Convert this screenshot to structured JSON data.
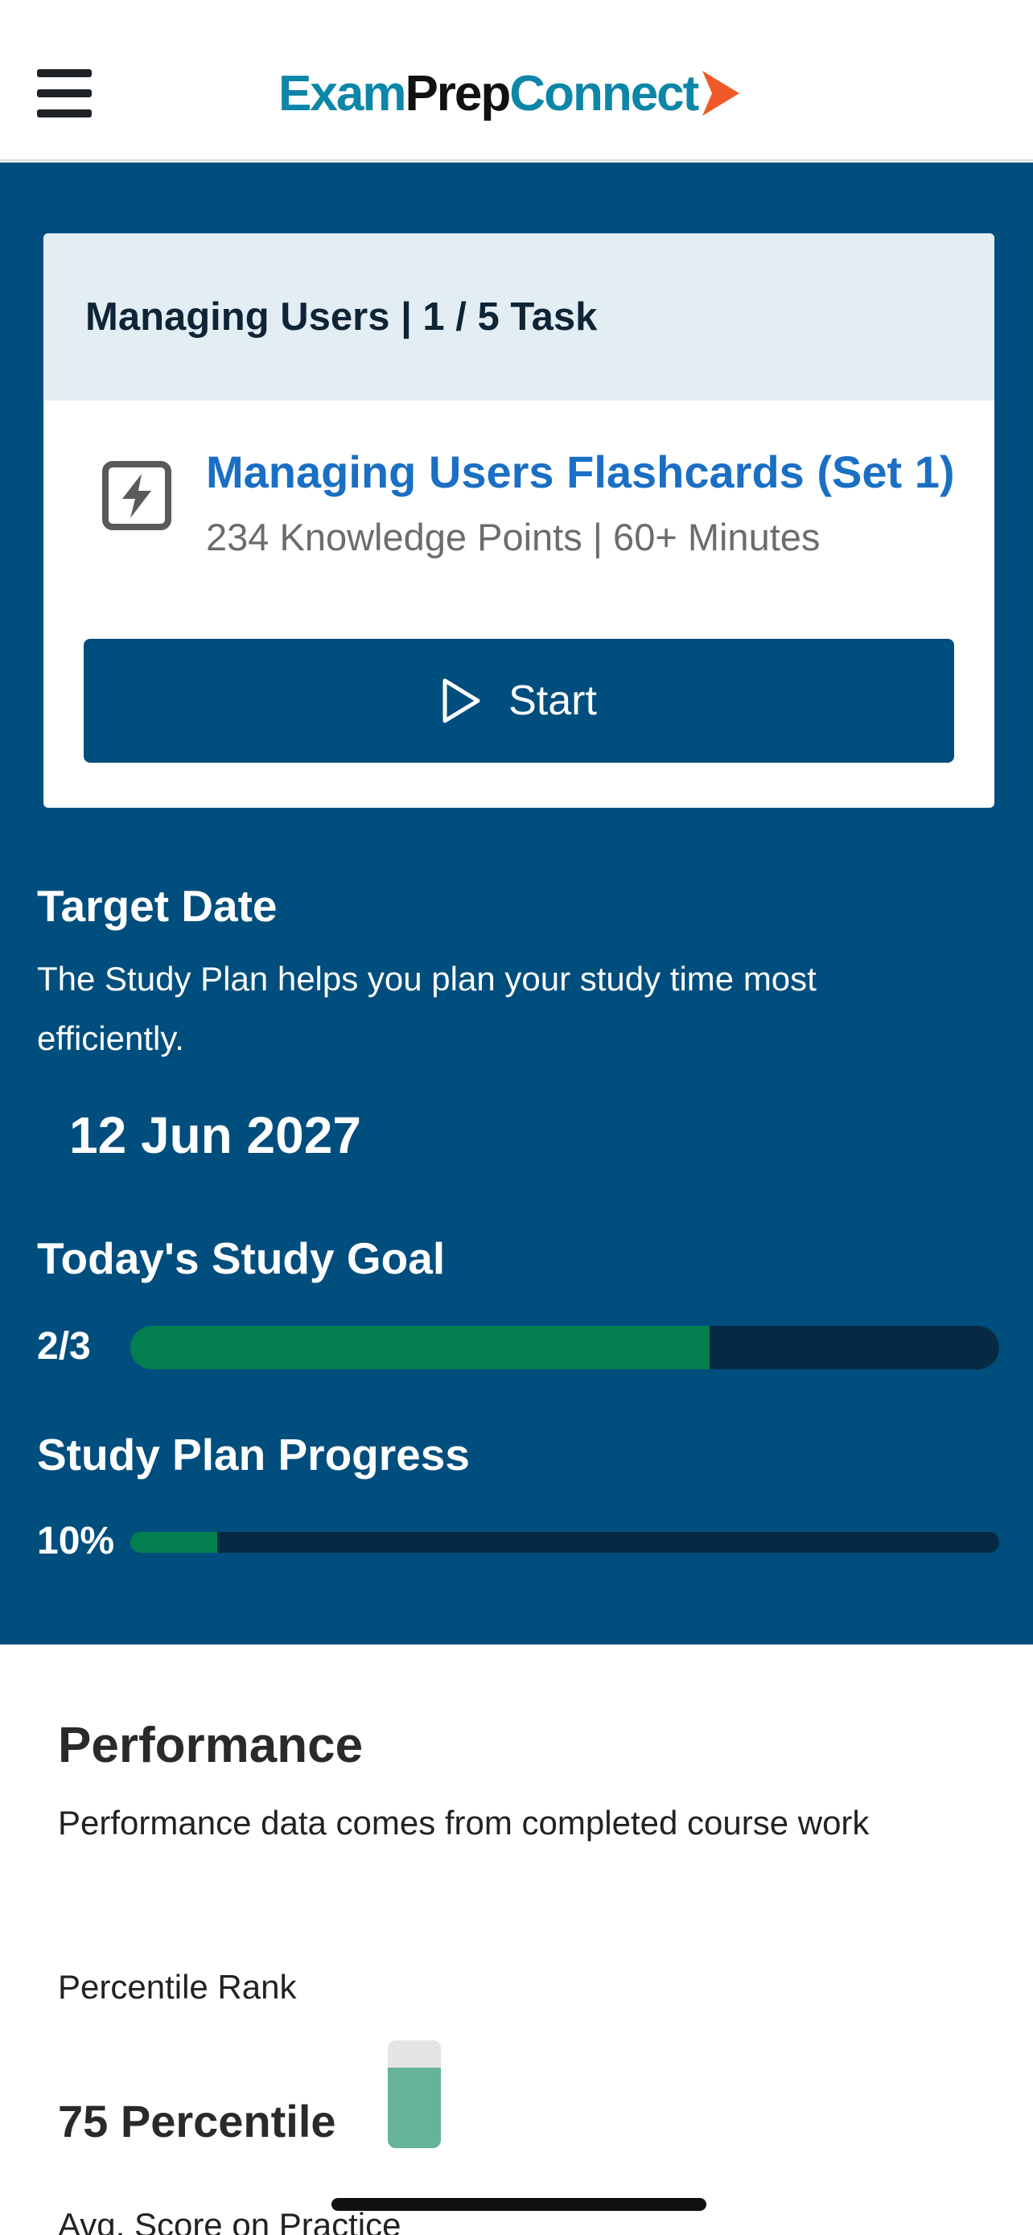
{
  "header": {
    "logo": {
      "part1": "Exam",
      "part2": "Prep",
      "part3": "Connect"
    },
    "colors": {
      "brand_blue": "#0d86a8",
      "brand_orange": "#f05a28"
    }
  },
  "task": {
    "header": "Managing Users | 1 / 5 Task",
    "item": {
      "title": "Managing Users Flashcards (Set 1)",
      "subtitle": "234 Knowledge Points | 60+ Minutes",
      "icon": "flashcard-bolt-icon"
    },
    "start_label": "Start"
  },
  "target_date": {
    "title": "Target Date",
    "description": "The Study Plan helps you plan your study time most efficiently.",
    "date": "12 Jun 2027"
  },
  "study_goal": {
    "title": "Today's Study Goal",
    "label": "2/3",
    "progress": 0.667
  },
  "plan_progress": {
    "title": "Study Plan Progress",
    "label": "10%",
    "progress": 0.1
  },
  "performance": {
    "title": "Performance",
    "subtitle": "Performance data comes from completed course work",
    "percentile_label": "Percentile Rank",
    "percentile_value": "75 Percentile",
    "percentile": 0.75,
    "avg_score_label": "Avg. Score on Practice"
  },
  "colors": {
    "primary": "#004e7e",
    "progress_fill": "#048050",
    "progress_track": "#062a44",
    "percentile_fill": "#66b497"
  }
}
